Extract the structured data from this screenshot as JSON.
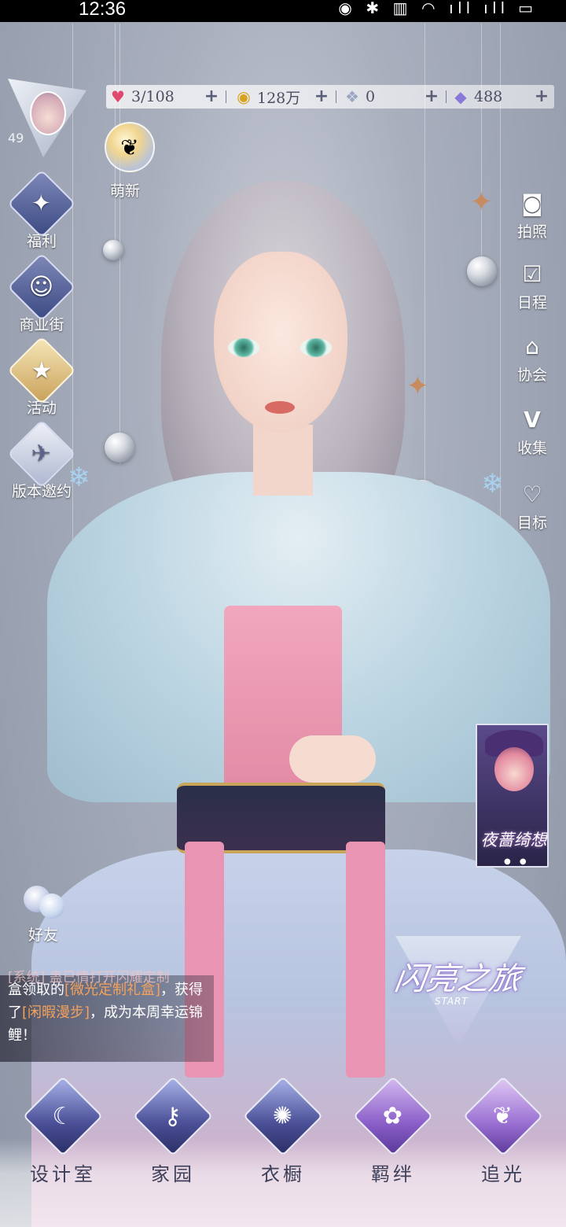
{
  "status_bar": {
    "time": "12:36",
    "icons": "◉ ✱ ▥ ◠ ıll ıll ▭"
  },
  "player": {
    "level": "49"
  },
  "resources": [
    {
      "icon": "heart-gem-icon",
      "glyph": "♥",
      "value": "3/108"
    },
    {
      "icon": "gold-coin-icon",
      "glyph": "◉",
      "value": "128万"
    },
    {
      "icon": "crystal-icon",
      "glyph": "❖",
      "value": "0"
    },
    {
      "icon": "diamond-icon",
      "glyph": "◆",
      "value": "488"
    }
  ],
  "left_menu": {
    "newbie": "萌新",
    "items": [
      {
        "label": "福利",
        "glyph": "✦"
      },
      {
        "label": "商业街",
        "glyph": "☺"
      },
      {
        "label": "活动",
        "glyph": "★"
      },
      {
        "label": "版本邀约",
        "glyph": "✈"
      }
    ]
  },
  "right_menu": [
    {
      "label": "拍照",
      "icon": "camera-icon",
      "glyph": "◙"
    },
    {
      "label": "日程",
      "icon": "calendar-icon",
      "glyph": "☑"
    },
    {
      "label": "协会",
      "icon": "guild-icon",
      "glyph": "⌂"
    },
    {
      "label": "收集",
      "icon": "collection-icon",
      "glyph": "V"
    },
    {
      "label": "目标",
      "icon": "target-icon",
      "glyph": "♡"
    }
  ],
  "banner": {
    "title": "夜蔷绮想",
    "dots": "● ●"
  },
  "friends": {
    "label": "好友"
  },
  "chat": {
    "top_line": "[系统] 蛊已情打开闪耀定制",
    "line1_prefix": "盒领取的",
    "line1_highlight": "[微光定制礼盒]",
    "line1_suffix": "，获得",
    "line2_prefix": "了",
    "line2_highlight": "[闲暇漫步]",
    "line2_suffix": "，成为本周幸运锦",
    "line3": "鲤！"
  },
  "start_logo": {
    "title": "闪亮之旅",
    "sub": "START"
  },
  "bottom_nav": [
    {
      "label": "设计室",
      "icon": "design-studio-icon",
      "glyph": "☾"
    },
    {
      "label": "家园",
      "icon": "home-key-icon",
      "glyph": "⚷"
    },
    {
      "label": "衣橱",
      "icon": "wardrobe-icon",
      "glyph": "✺"
    },
    {
      "label": "羁绊",
      "icon": "bond-icon",
      "glyph": "✿"
    },
    {
      "label": "追光",
      "icon": "chase-light-icon",
      "glyph": "❦"
    }
  ]
}
